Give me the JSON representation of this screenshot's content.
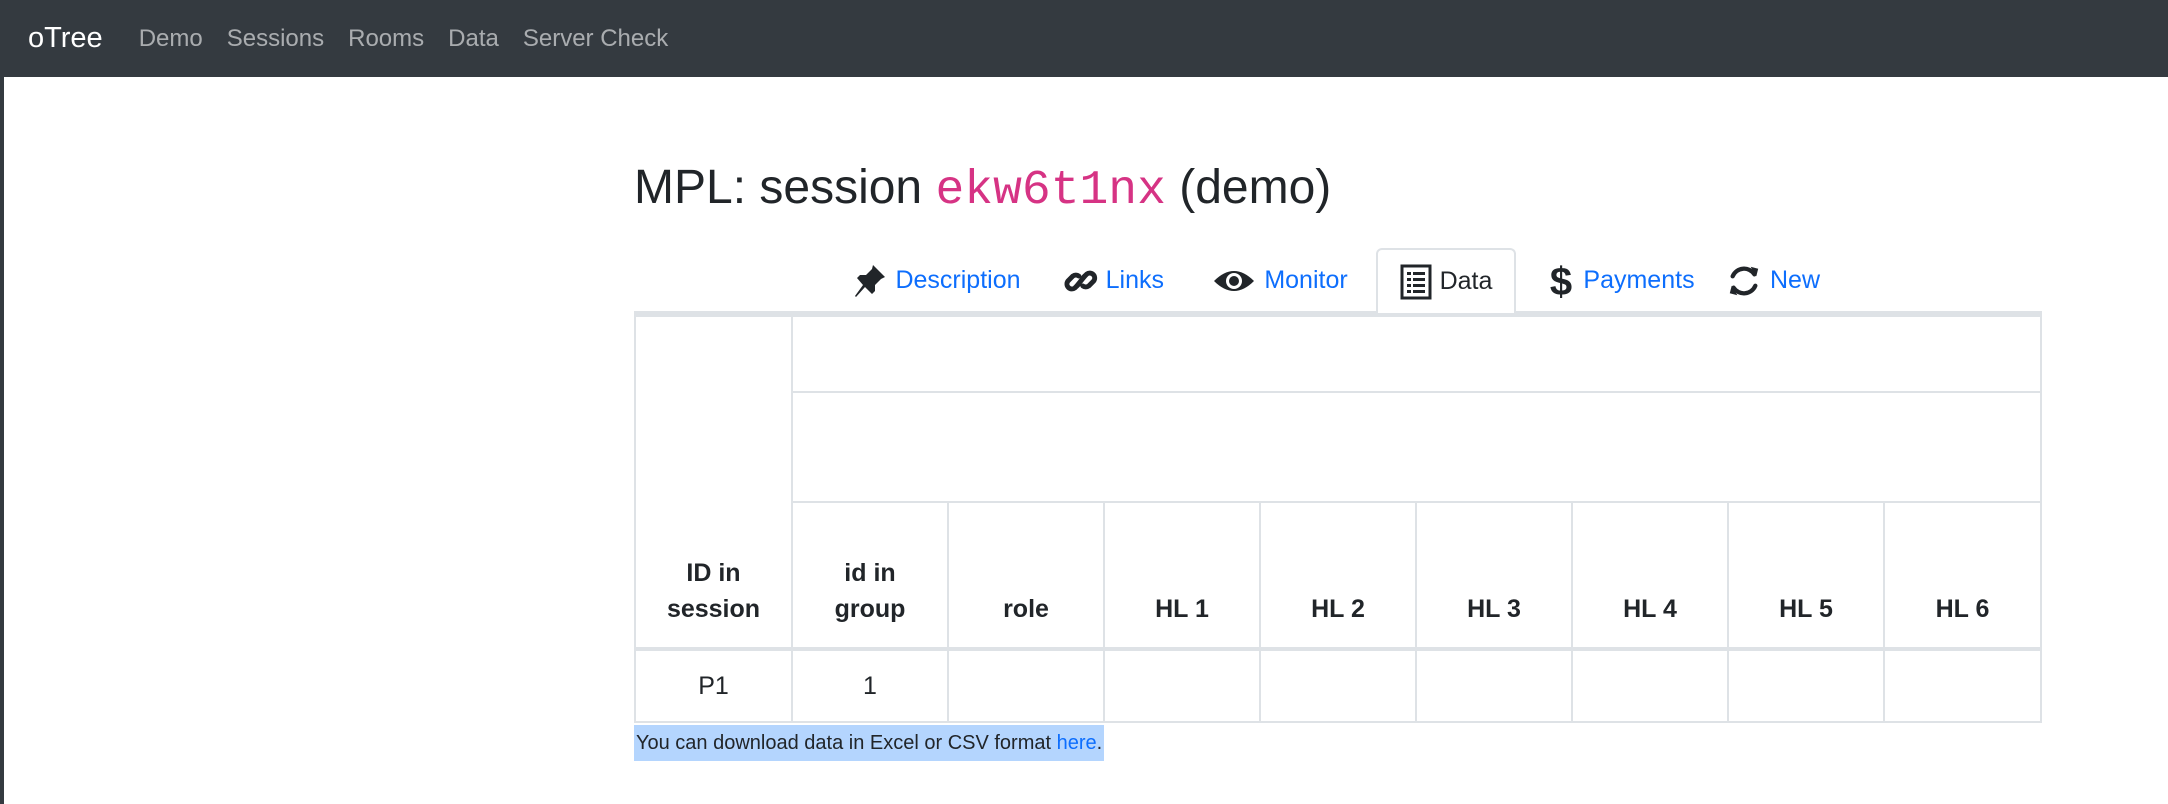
{
  "navbar": {
    "brand": "oTree",
    "links": [
      "Demo",
      "Sessions",
      "Rooms",
      "Data",
      "Server Check"
    ]
  },
  "page": {
    "title_prefix": "MPL: session",
    "session_code": "ekw6t1nx",
    "title_suffix": "(demo)"
  },
  "tabs": [
    {
      "label": "Description",
      "icon": "pushpin-icon"
    },
    {
      "label": "Links",
      "icon": "link-icon"
    },
    {
      "label": "Monitor",
      "icon": "eye-icon"
    },
    {
      "label": "Data",
      "icon": "list-icon",
      "active": true
    },
    {
      "label": "Payments",
      "icon": "dollar-icon"
    },
    {
      "label": "New",
      "icon": "refresh-icon"
    }
  ],
  "table": {
    "columns": [
      {
        "line1": "ID in",
        "line2": "session"
      },
      {
        "line1": "id in",
        "line2": "group"
      },
      {
        "line1": "",
        "line2": "role"
      },
      {
        "line1": "",
        "line2": "HL 1"
      },
      {
        "line1": "",
        "line2": "HL 2"
      },
      {
        "line1": "",
        "line2": "HL 3"
      },
      {
        "line1": "",
        "line2": "HL 4"
      },
      {
        "line1": "",
        "line2": "HL 5"
      },
      {
        "line1": "",
        "line2": "HL 6"
      }
    ],
    "rows": [
      [
        "P1",
        "1",
        "",
        "",
        "",
        "",
        "",
        "",
        ""
      ]
    ]
  },
  "footer": {
    "download_text": "You can download data in Excel or CSV format ",
    "download_link": "here",
    "download_end": "."
  },
  "colors": {
    "navbar_bg": "#343a40",
    "link": "#0d6efd",
    "code": "#d63384",
    "selection": "#b4d5fe"
  }
}
